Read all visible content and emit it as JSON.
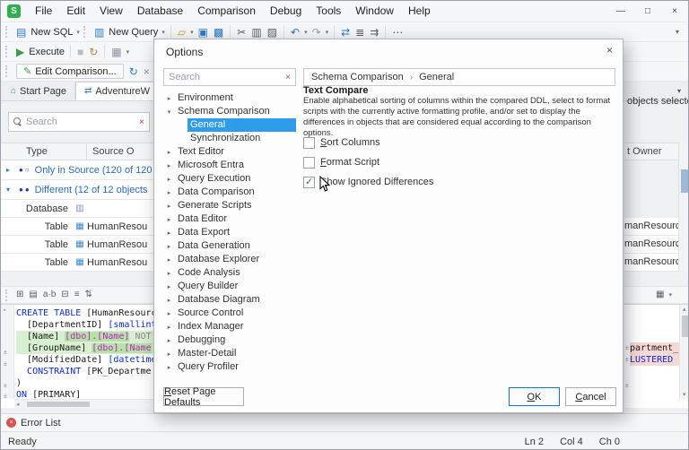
{
  "colors": {
    "accent_selection": "#2f9ceb",
    "keyword_blue": "#0a2ecc",
    "user_type_magenta": "#c021c0",
    "diff_source_green": "#d9efd2",
    "diff_target_pink": "#f7d8d6",
    "group_text_blue": "#2a6cc0",
    "app_icon_green": "#2fae4e"
  },
  "titlebar": {
    "app_initial": "S",
    "menus": [
      "File",
      "Edit",
      "View",
      "Database",
      "Comparison",
      "Debug",
      "Tools",
      "Window",
      "Help"
    ],
    "window_controls": [
      {
        "name": "minimize-button",
        "glyph": "—"
      },
      {
        "name": "maximize-button",
        "glyph": "□"
      },
      {
        "name": "close-button",
        "glyph": "×"
      }
    ]
  },
  "toolbar_main": {
    "overflow_glyph": "▾",
    "atoms": [
      {
        "k": "grip"
      },
      {
        "k": "icon",
        "t": "▤",
        "name": "new-sql-icon",
        "tint": "#2e79c7"
      },
      {
        "k": "label",
        "t": "New SQL",
        "name": "new-sql-button"
      },
      {
        "k": "caret",
        "t": "▾",
        "name": "new-sql-dropdown-icon"
      },
      {
        "k": "grip"
      },
      {
        "k": "icon",
        "t": "▥",
        "name": "new-query-icon",
        "tint": "#2e79c7"
      },
      {
        "k": "label",
        "t": "New Query",
        "name": "new-query-button"
      },
      {
        "k": "caret",
        "t": "▾",
        "name": "new-query-dropdown-icon"
      },
      {
        "k": "sep"
      },
      {
        "k": "icon",
        "t": "▱",
        "name": "open-file-icon",
        "tint": "#c99b3f"
      },
      {
        "k": "caret",
        "t": "▾",
        "name": "open-file-dropdown-icon"
      },
      {
        "k": "icon",
        "t": "▣",
        "name": "save-icon",
        "tint": "#2e79c7"
      },
      {
        "k": "icon",
        "t": "▩",
        "name": "save-all-icon",
        "tint": "#2e79c7"
      },
      {
        "k": "sep"
      },
      {
        "k": "icon",
        "t": "✂",
        "name": "cut-icon",
        "tint": "#5a5f66"
      },
      {
        "k": "icon",
        "t": "▥",
        "name": "copy-icon",
        "tint": "#5a5f66"
      },
      {
        "k": "icon",
        "t": "▨",
        "name": "paste-icon",
        "tint": "#5a5f66"
      },
      {
        "k": "sep"
      },
      {
        "k": "icon",
        "t": "↶",
        "name": "undo-icon",
        "tint": "#3f6fbe"
      },
      {
        "k": "caret",
        "t": "▾",
        "name": "undo-dropdown-icon"
      },
      {
        "k": "icon",
        "t": "↷",
        "name": "redo-icon",
        "tint": "#9aa0a8"
      },
      {
        "k": "caret",
        "t": "▾",
        "name": "redo-dropdown-icon"
      },
      {
        "k": "sep"
      },
      {
        "k": "icon",
        "t": "⇄",
        "name": "compare-icon",
        "tint": "#2e79c7"
      },
      {
        "k": "icon",
        "t": "≣",
        "name": "results-list-icon",
        "tint": "#5a5f66"
      },
      {
        "k": "icon",
        "t": "⇉",
        "name": "goto-icon",
        "tint": "#5a5f66"
      },
      {
        "k": "sep"
      },
      {
        "k": "icon",
        "t": "⋯",
        "name": "more-commands-icon",
        "tint": "#5a5f66"
      }
    ]
  },
  "toolbar_exec": {
    "atoms": [
      {
        "k": "grip"
      },
      {
        "k": "icon",
        "t": "▶",
        "name": "execute-icon",
        "tint": "#3c9e46"
      },
      {
        "k": "label",
        "t": "Execute",
        "name": "execute-button"
      },
      {
        "k": "sep"
      },
      {
        "k": "icon",
        "t": "■",
        "name": "stop-icon",
        "tint": "#b9bec4"
      },
      {
        "k": "icon",
        "t": "↻",
        "name": "refresh-icon",
        "tint": "#c87f3a"
      },
      {
        "k": "sep"
      },
      {
        "k": "icon",
        "t": "▦",
        "name": "results-grid-icon",
        "tint": "#8a93a0"
      },
      {
        "k": "caret",
        "t": "▾",
        "name": "execute-options-dropdown-icon"
      }
    ]
  },
  "comparison_bar": {
    "edit_icon_glyph": "✎",
    "edit_comparison_label": "Edit Comparison...",
    "refresh_glyph": "↻",
    "close_glyph": "×"
  },
  "tabstrip": {
    "overflow_glyph": "▾",
    "tabs": [
      {
        "icon": "⌂",
        "icon_tint": "#3a87c8",
        "label": "Start Page",
        "active": false
      },
      {
        "icon": "⇄",
        "icon_tint": "#2e79c7",
        "label": "AdventureW",
        "active": true
      }
    ]
  },
  "results_panel": {
    "search_placeholder": "Search",
    "search_clear_glyph": "×",
    "selection_status": "objects selected",
    "grid": {
      "col_type": "Type",
      "col_source": "Source O",
      "col_owner_fragment": "t Owner",
      "groups": [
        {
          "arrow": "▸",
          "bullets": "●○",
          "label": "Only in Source (120 of 120"
        },
        {
          "arrow": "▾",
          "bullets": "●●",
          "label": "Different (12 of 12 objects"
        }
      ],
      "rows": [
        {
          "type": "Database",
          "icon": "▥",
          "tint": "#8a93a0",
          "source": ""
        },
        {
          "type": "Table",
          "icon": "▦",
          "tint": "#3a87c8",
          "source": "HumanResou"
        },
        {
          "type": "Table",
          "icon": "▦",
          "tint": "#3a87c8",
          "source": "HumanResou"
        },
        {
          "type": "Table",
          "icon": "▦",
          "tint": "#3a87c8",
          "source": "HumanResou"
        }
      ],
      "owner_rows": [
        "manResources",
        "manResources",
        "manResources"
      ]
    }
  },
  "editor_toolbar": {
    "left_atoms": [
      {
        "k": "grip"
      },
      {
        "k": "icon",
        "t": "⊞",
        "name": "diff-map-icon",
        "tint": "#5a5f66"
      },
      {
        "k": "icon",
        "t": "▤",
        "name": "layout-icon",
        "tint": "#5a5f66"
      },
      {
        "k": "icon",
        "t": "a·b",
        "name": "word-diff-icon",
        "tint": "#5a5f66"
      },
      {
        "k": "icon",
        "t": "⊟",
        "name": "collapse-regions-icon",
        "tint": "#5a5f66"
      },
      {
        "k": "icon",
        "t": "≡",
        "name": "ignore-lines-icon",
        "tint": "#5a5f66"
      },
      {
        "k": "icon",
        "t": "⇅",
        "name": "sync-scroll-icon",
        "tint": "#5a5f66"
      }
    ],
    "right_atoms": [
      {
        "k": "icon",
        "t": "▦",
        "name": "script-view-icon",
        "tint": "#5a5f66"
      },
      {
        "k": "caret",
        "t": "▾",
        "name": "script-view-dropdown-icon"
      }
    ]
  },
  "script_diff": {
    "left_lines": [
      {
        "segs": [
          {
            "t": "CREATE TABLE",
            "c": "kw"
          },
          {
            "t": " [HumanResourc",
            "c": "id"
          }
        ]
      },
      {
        "segs": [
          {
            "t": "  [DepartmentID] ",
            "c": "id"
          },
          {
            "t": "[smallint",
            "c": "kw"
          }
        ]
      },
      {
        "bg": "green",
        "segs": [
          {
            "t": "  [Name] ",
            "c": "id"
          },
          {
            "t": "[dbo].[Name]",
            "c": "typ",
            "hl": true
          },
          {
            "t": " NOT",
            "c": "gr"
          }
        ]
      },
      {
        "bg": "green",
        "segs": [
          {
            "t": "  [GroupName] ",
            "c": "id"
          },
          {
            "t": "[dbo].[Name",
            "c": "typ",
            "hl": true
          }
        ]
      },
      {
        "segs": [
          {
            "t": "  [ModifiedDate] ",
            "c": "id"
          },
          {
            "t": "[datetime",
            "c": "kw"
          }
        ]
      },
      {
        "segs": [
          {
            "t": "  ",
            "c": "id"
          },
          {
            "t": "CONSTRAINT",
            "c": "kw"
          },
          {
            "t": " [PK_Departme",
            "c": "id"
          }
        ]
      },
      {
        "segs": [
          {
            "t": ")",
            "c": "id"
          }
        ]
      },
      {
        "segs": [
          {
            "t": "ON",
            "c": "kw"
          },
          {
            "t": " [PRIMARY]",
            "c": "id"
          }
        ]
      }
    ],
    "right_lines": [
      {
        "segs": [
          {
            "t": " ",
            "c": "id"
          }
        ]
      },
      {
        "segs": [
          {
            "t": " ",
            "c": "id"
          }
        ]
      },
      {
        "segs": [
          {
            "t": " ",
            "c": "id"
          }
        ]
      },
      {
        "bg": "pink",
        "segs": [
          {
            "t": "partment_",
            "c": "id"
          }
        ]
      },
      {
        "bg": "pink",
        "segs": [
          {
            "t": "LUSTERED",
            "c": "kw"
          }
        ]
      },
      {
        "segs": [
          {
            "t": " ",
            "c": "id"
          }
        ]
      }
    ]
  },
  "error_list": {
    "label": "Error List"
  },
  "status_bar": {
    "ready": "Ready",
    "position": [
      "Ln 2",
      "Col 4",
      "Ch 0"
    ]
  },
  "options_dialog": {
    "title": "Options",
    "close_glyph": "×",
    "search_placeholder": "Search",
    "search_clear_glyph": "×",
    "tree": [
      {
        "arrow": "▸",
        "label": "Environment"
      },
      {
        "arrow": "▾",
        "label": "Schema Comparison"
      },
      {
        "label": "General",
        "level1": true,
        "selected": true
      },
      {
        "label": "Synchronization",
        "level1": true
      },
      {
        "arrow": "▸",
        "label": "Text Editor"
      },
      {
        "arrow": "▸",
        "label": "Microsoft Entra"
      },
      {
        "arrow": "▸",
        "label": "Query Execution"
      },
      {
        "arrow": "▸",
        "label": "Data Comparison"
      },
      {
        "arrow": "▸",
        "label": "Generate Scripts"
      },
      {
        "arrow": "▸",
        "label": "Data Editor"
      },
      {
        "arrow": "▸",
        "label": "Data Export"
      },
      {
        "arrow": "▸",
        "label": "Data Generation"
      },
      {
        "arrow": "▸",
        "label": "Database Explorer"
      },
      {
        "arrow": "▸",
        "label": "Code Analysis"
      },
      {
        "arrow": "▸",
        "label": "Query Builder"
      },
      {
        "arrow": "▸",
        "label": "Database Diagram"
      },
      {
        "arrow": "▸",
        "label": "Source Control"
      },
      {
        "arrow": "▸",
        "label": "Index Manager"
      },
      {
        "arrow": "▸",
        "label": "Debugging"
      },
      {
        "arrow": "▸",
        "label": "Master-Detail"
      },
      {
        "arrow": "▸",
        "label": "Query Profiler"
      }
    ],
    "breadcrumb": {
      "first": "Schema Comparison",
      "sep": "›",
      "second": "General"
    },
    "content": {
      "heading": "Text Compare",
      "description": "Enable alphabetical sorting of columns within the compared DDL, select to format scripts with the currently active formatting profile, and/or set to display the differences in objects that are considered equal according to the comparison options.",
      "checkboxes": [
        {
          "label": "Sort Columns",
          "checked": false
        },
        {
          "label": "Format Script",
          "checked": false
        },
        {
          "label": "Show Ignored Differences",
          "checked": true
        }
      ]
    },
    "buttons": {
      "reset": "Reset Page Defaults",
      "ok": "OK",
      "cancel": "Cancel"
    }
  }
}
